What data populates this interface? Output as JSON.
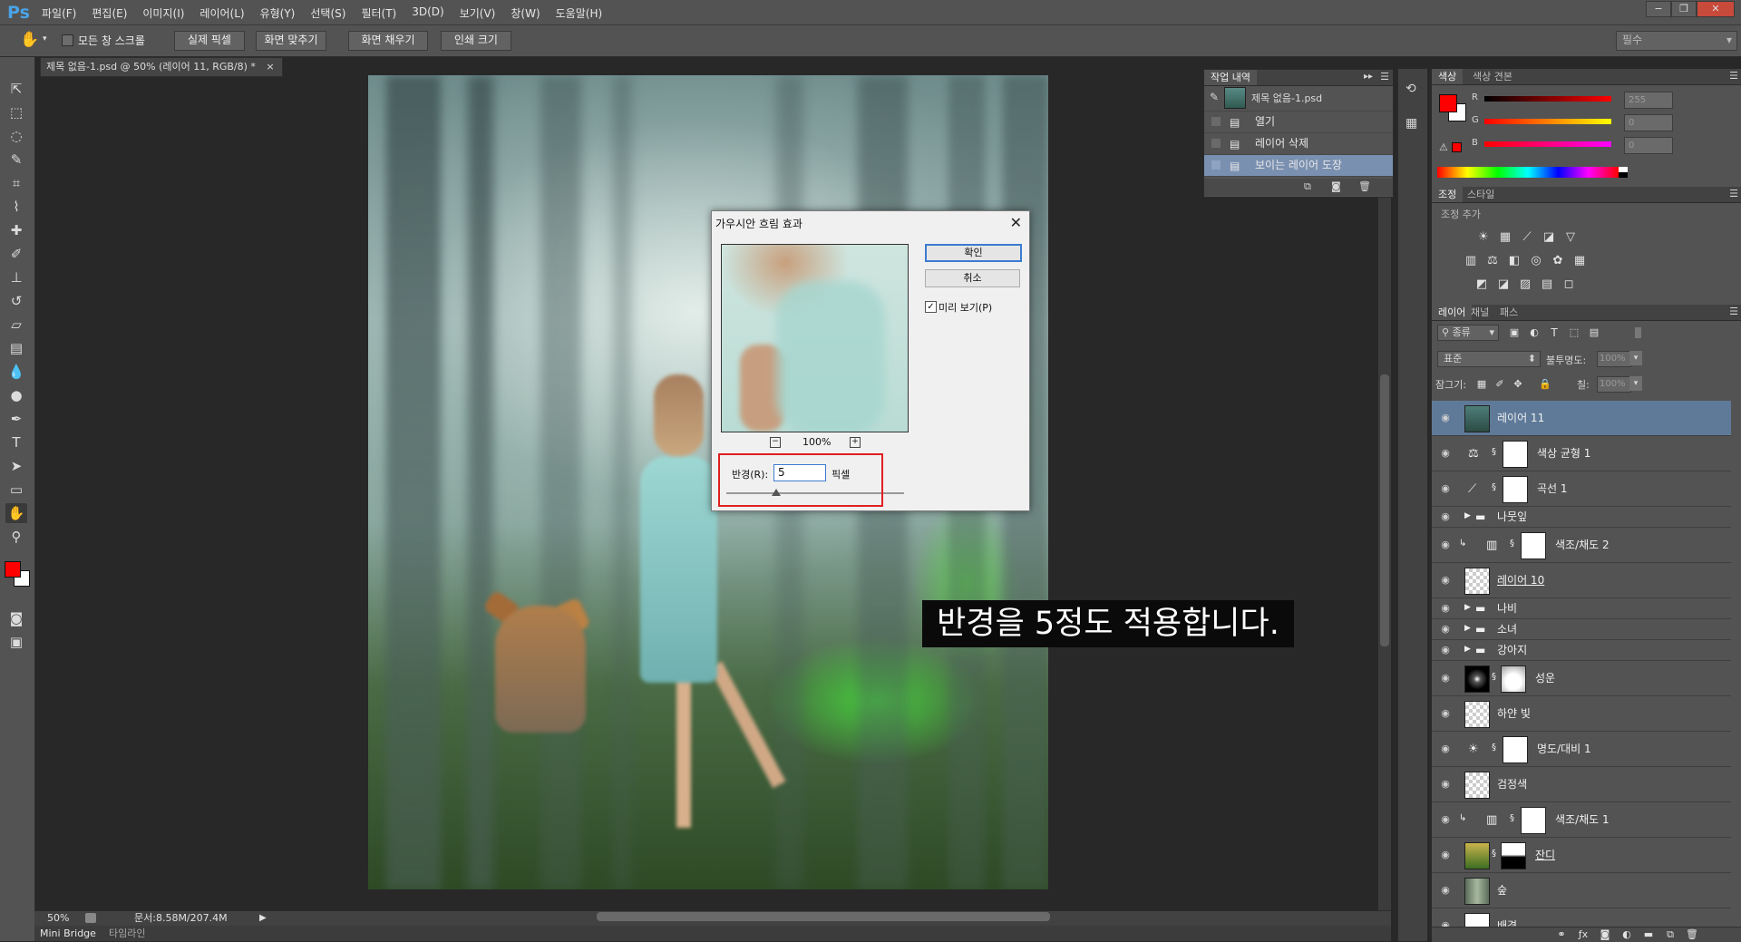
{
  "app": {
    "logo": "Ps",
    "menus": [
      "파일(F)",
      "편집(E)",
      "이미지(I)",
      "레이어(L)",
      "유형(Y)",
      "선택(S)",
      "필터(T)",
      "3D(D)",
      "보기(V)",
      "창(W)",
      "도움말(H)"
    ],
    "workspace": "필수"
  },
  "options_bar": {
    "scroll_all_label": "모든 창 스크롤",
    "buttons": [
      "실제 픽셀",
      "화면 맞추기",
      "화면 채우기",
      "인쇄 크기"
    ]
  },
  "document": {
    "tab_title": "제목 없음-1.psd @ 50% (레이어 11, RGB/8) *",
    "zoom": "50%",
    "doc_size": "문서:8.58M/207.4M",
    "caption": "반경을 5정도 적용합니다."
  },
  "bottom_tabs": [
    "Mini Bridge",
    "타임라인"
  ],
  "history_panel": {
    "tabs": [
      "작업 내역"
    ],
    "snapshot": "제목 없음-1.psd",
    "items": [
      "열기",
      "레이어 삭제",
      "보이는 레이어 도장"
    ],
    "selected_index": 2
  },
  "color_panel": {
    "tabs": [
      "색상",
      "색상 견본"
    ],
    "channels": [
      {
        "label": "R",
        "value": "255"
      },
      {
        "label": "G",
        "value": "0"
      },
      {
        "label": "B",
        "value": "0"
      }
    ],
    "foreground": "#ff0000",
    "background": "#ffffff"
  },
  "adjust_panel": {
    "tabs": [
      "조정",
      "스타일"
    ],
    "add_label": "조정 추가"
  },
  "layers_panel": {
    "tabs": [
      "레이어",
      "채널",
      "패스"
    ],
    "filter_label": "종류",
    "blend_mode": "표준",
    "opacity_label": "불투명도:",
    "opacity_value": "100%",
    "lock_label": "잠그기:",
    "fill_label": "칠:",
    "fill_value": "100%",
    "layers": [
      {
        "name": "레이어 11",
        "kind": "image",
        "selected": true
      },
      {
        "name": "색상 균형 1",
        "kind": "adjust",
        "icon": "balance"
      },
      {
        "name": "곡선 1",
        "kind": "adjust",
        "icon": "curves"
      },
      {
        "name": "나뭇잎",
        "kind": "group"
      },
      {
        "name": "색조/채도 2",
        "kind": "adjust",
        "icon": "huesat",
        "clipped": true
      },
      {
        "name": "레이어 10",
        "kind": "image",
        "underline": true
      },
      {
        "name": "나비",
        "kind": "group"
      },
      {
        "name": "소녀",
        "kind": "group"
      },
      {
        "name": "강아지",
        "kind": "group"
      },
      {
        "name": "성운",
        "kind": "image-mask"
      },
      {
        "name": "하얀 빛",
        "kind": "image"
      },
      {
        "name": "명도/대비 1",
        "kind": "adjust",
        "icon": "brightness"
      },
      {
        "name": "검정색",
        "kind": "image"
      },
      {
        "name": "색조/채도 1",
        "kind": "adjust",
        "icon": "huesat",
        "clipped": true
      },
      {
        "name": "잔디",
        "kind": "image-mask",
        "underline": true
      },
      {
        "name": "숲",
        "kind": "image"
      },
      {
        "name": "배경",
        "kind": "image"
      }
    ]
  },
  "dialog": {
    "title": "가우시안 흐림 효과",
    "ok": "확인",
    "cancel": "취소",
    "preview_label": "미리 보기(P)",
    "preview_checked": true,
    "zoom": "100%",
    "radius_label": "반경(R):",
    "radius_value": "5",
    "unit": "픽셀"
  }
}
